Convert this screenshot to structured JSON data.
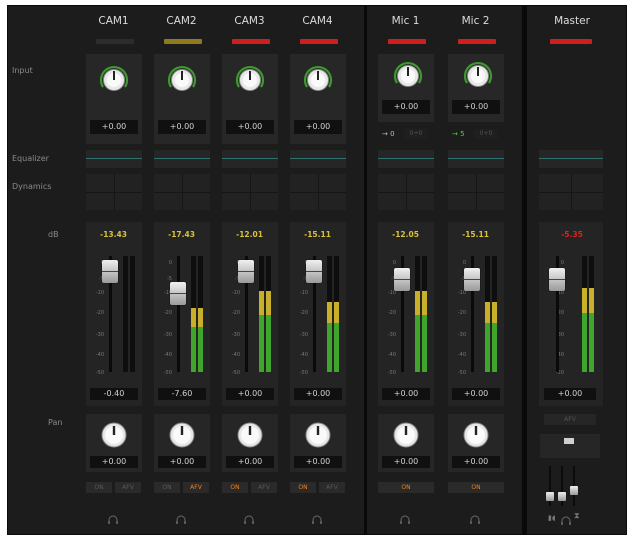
{
  "row_labels": {
    "input": "Input",
    "equalizer": "Equalizer",
    "dynamics": "Dynamics",
    "db": "dB",
    "pan": "Pan"
  },
  "channels": [
    {
      "name": "CAM1",
      "tally": "dark",
      "input_value": "+0.00",
      "level": "-13.43",
      "fader": "-0.40",
      "pan_value": "+0.00",
      "btn1": "ON",
      "btn2": "AFV",
      "btn1_active": false,
      "btn2_active": false,
      "meter_fill": 0.0
    },
    {
      "name": "CAM2",
      "tally": "yellow",
      "input_value": "+0.00",
      "level": "-17.43",
      "fader": "-7.60",
      "pan_value": "+0.00",
      "btn1": "ON",
      "btn2": "AFV",
      "btn1_active": false,
      "btn2_active": true,
      "meter_fill": 0.55
    },
    {
      "name": "CAM3",
      "tally": "red",
      "input_value": "+0.00",
      "level": "-12.01",
      "fader": "+0.00",
      "pan_value": "+0.00",
      "btn1": "ON",
      "btn2": "AFV",
      "btn1_active": true,
      "btn2_active": false,
      "meter_fill": 0.7
    },
    {
      "name": "CAM4",
      "tally": "red",
      "input_value": "+0.00",
      "level": "-15.11",
      "fader": "+0.00",
      "pan_value": "+0.00",
      "btn1": "ON",
      "btn2": "AFV",
      "btn1_active": true,
      "btn2_active": false,
      "meter_fill": 0.6
    }
  ],
  "mics": [
    {
      "name": "Mic 1",
      "tally": "red",
      "input_value": "+0.00",
      "route_a": "0",
      "route_b": "0+0",
      "route_active": false,
      "level": "-12.05",
      "fader": "+0.00",
      "pan_value": "+0.00",
      "btn": "ON",
      "meter_fill": 0.7
    },
    {
      "name": "Mic 2",
      "tally": "red",
      "input_value": "+0.00",
      "route_a": "5",
      "route_b": "0+0",
      "route_active": true,
      "level": "-15.11",
      "fader": "+0.00",
      "pan_value": "+0.00",
      "btn": "ON",
      "meter_fill": 0.6
    }
  ],
  "master": {
    "name": "Master",
    "tally": "red",
    "level": "-5.35",
    "fader": "+0.00",
    "meter_fill": 0.72,
    "afv_label": "AFV"
  },
  "scale": [
    "0",
    "-5",
    "-10",
    "-20",
    "-30",
    "-40",
    "-50"
  ],
  "colors": {
    "tally_red": "#d01e1e",
    "tally_yellow": "#8f7a1e",
    "level_yellow": "#d9c13d",
    "level_red": "#e02020",
    "eq_line": "#2f6f6c",
    "meter_green": "#3fa52d",
    "meter_yellow": "#c8b02a",
    "on_orange": "#f08020"
  }
}
